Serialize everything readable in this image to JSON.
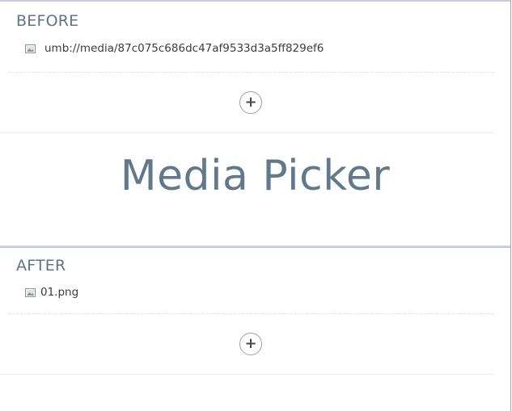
{
  "before": {
    "heading": "BEFORE",
    "media_item": {
      "icon": "image-icon",
      "label": "umb://media/87c075c686dc47af9533d3a5ff829ef6"
    },
    "add_button": {
      "icon": "plus-icon",
      "glyph": "+"
    }
  },
  "title": "Media Picker",
  "after": {
    "heading": "AFTER",
    "media_item": {
      "icon": "image-icon",
      "label": "01.png"
    },
    "add_button": {
      "icon": "plus-icon",
      "glyph": "+"
    }
  },
  "colors": {
    "heading": "#5f7486",
    "title": "#62798c",
    "text": "#3c3c3c",
    "button_border": "#9aa0a6"
  }
}
